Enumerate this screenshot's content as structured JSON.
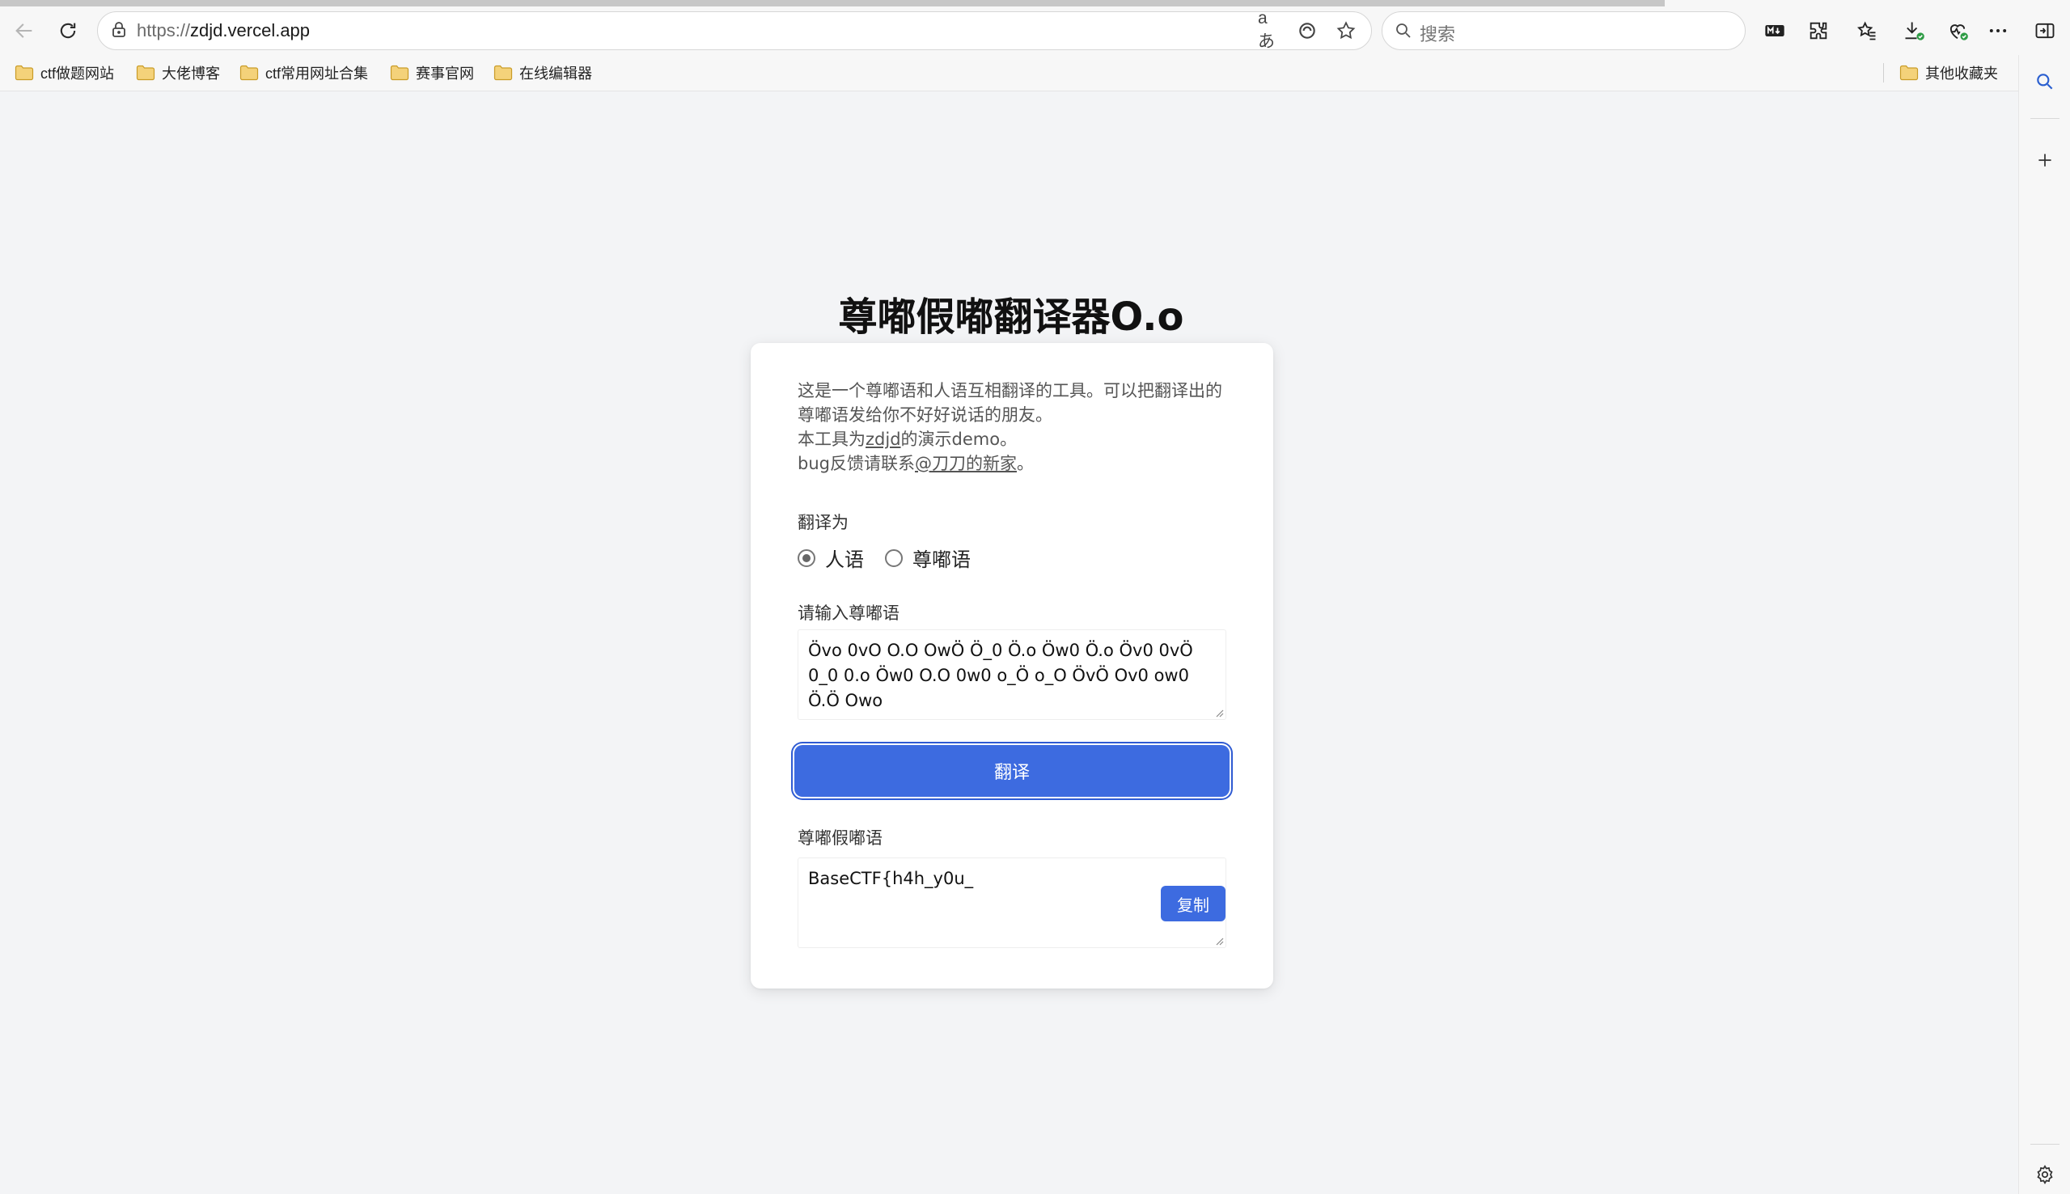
{
  "browser": {
    "url_scheme": "https://",
    "url_host": "zdjd.vercel.app",
    "translate_icon_text": "aあ",
    "search_placeholder": "搜索",
    "favorites": [
      "ctf做题网站",
      "大佬博客",
      "ctf常用网址合集",
      "赛事官网",
      "在线编辑器"
    ],
    "other_favorites": "其他收藏夹"
  },
  "page": {
    "title": "尊嘟假嘟翻译器O.o",
    "desc_line1": "这是一个尊嘟语和人语互相翻译的工具。可以把翻译出的尊嘟语发给你不好好说话的朋友。",
    "desc_line2_prefix": "本工具为",
    "desc_line2_link": "zdjd",
    "desc_line2_suffix": "的演示demo。",
    "desc_line3_prefix": "bug反馈请联系",
    "desc_line3_link": "@刀刀的新家",
    "desc_line3_suffix": "。",
    "translate_to_label": "翻译为",
    "options": [
      {
        "label": "人语",
        "selected": true
      },
      {
        "label": "尊嘟语",
        "selected": false
      }
    ],
    "input_label": "请输入尊嘟语",
    "input_value": "Övo 0vO O.O OwÖ Ö_0 Ö.o Öw0 Ö.o Öv0 0vÖ 0_0 0.o Öw0 O.O 0w0 o_Ö o_O ÖvÖ Ov0 ow0 Ö.Ö Owo",
    "translate_button": "翻译",
    "output_label": "尊嘟假嘟语",
    "output_value": "BaseCTF{h4h_y0u_",
    "copy_button": "复制"
  },
  "colors": {
    "accent": "#3d6be0",
    "page_bg": "#f3f4f6",
    "card_bg": "#ffffff"
  }
}
